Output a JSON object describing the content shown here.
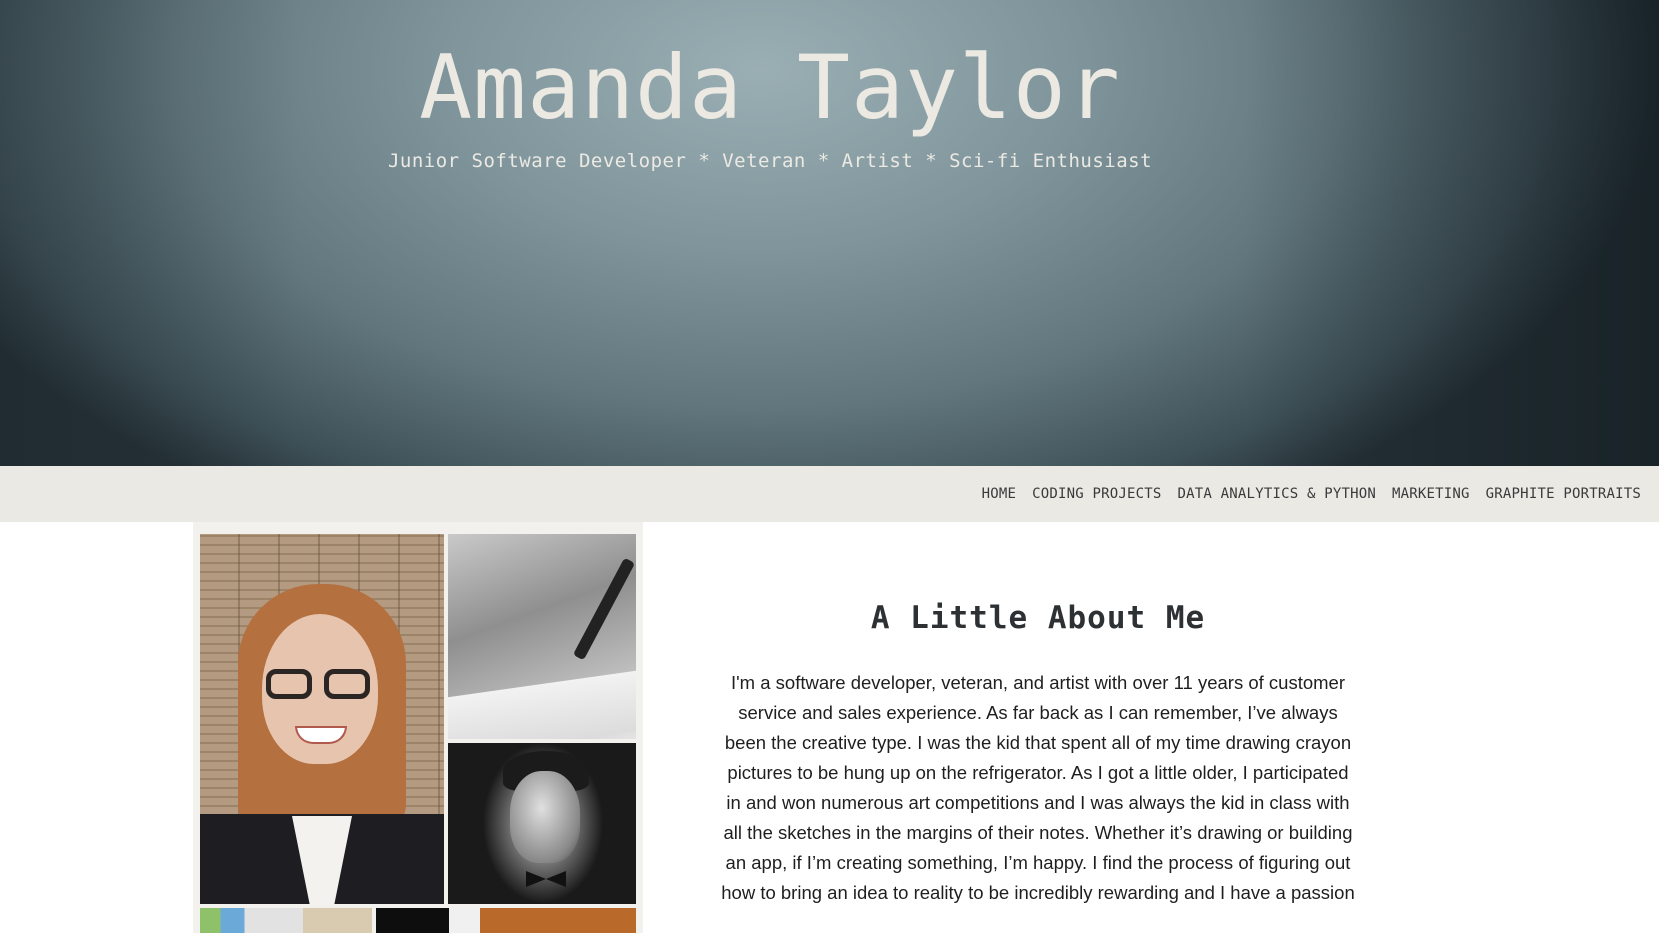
{
  "header": {
    "name": "Amanda Taylor",
    "tagline": "Junior Software Developer * Veteran * Artist * Sci-fi Enthusiast"
  },
  "nav": {
    "items": [
      {
        "label": "HOME"
      },
      {
        "label": "CODING PROJECTS"
      },
      {
        "label": "DATA ANALYTICS & PYTHON"
      },
      {
        "label": "MARKETING"
      },
      {
        "label": "GRAPHITE PORTRAITS"
      }
    ]
  },
  "about": {
    "title": "A Little About Me",
    "body": "I'm a software developer, veteran, and artist with over 11 years of customer service and sales experience. As far back as I can remember, I’ve always been the creative type. I was the kid that spent all of my time drawing crayon pictures to be hung up on the refrigerator. As I got a little older, I participated in and won numerous art competitions and I was always the kid in class with all the sketches in the margins of their notes. Whether it’s drawing or building an app, if I’m creating something, I’m happy. I find the process of figuring out how to bring an idea to reality to be incredibly rewarding and I have a passion"
  },
  "colors": {
    "hero_light": "#9aafb4",
    "hero_dark": "#253137",
    "navbar_bg": "#ebe9e4",
    "title_text": "#ece9e3",
    "heading_text": "#2d3133"
  }
}
